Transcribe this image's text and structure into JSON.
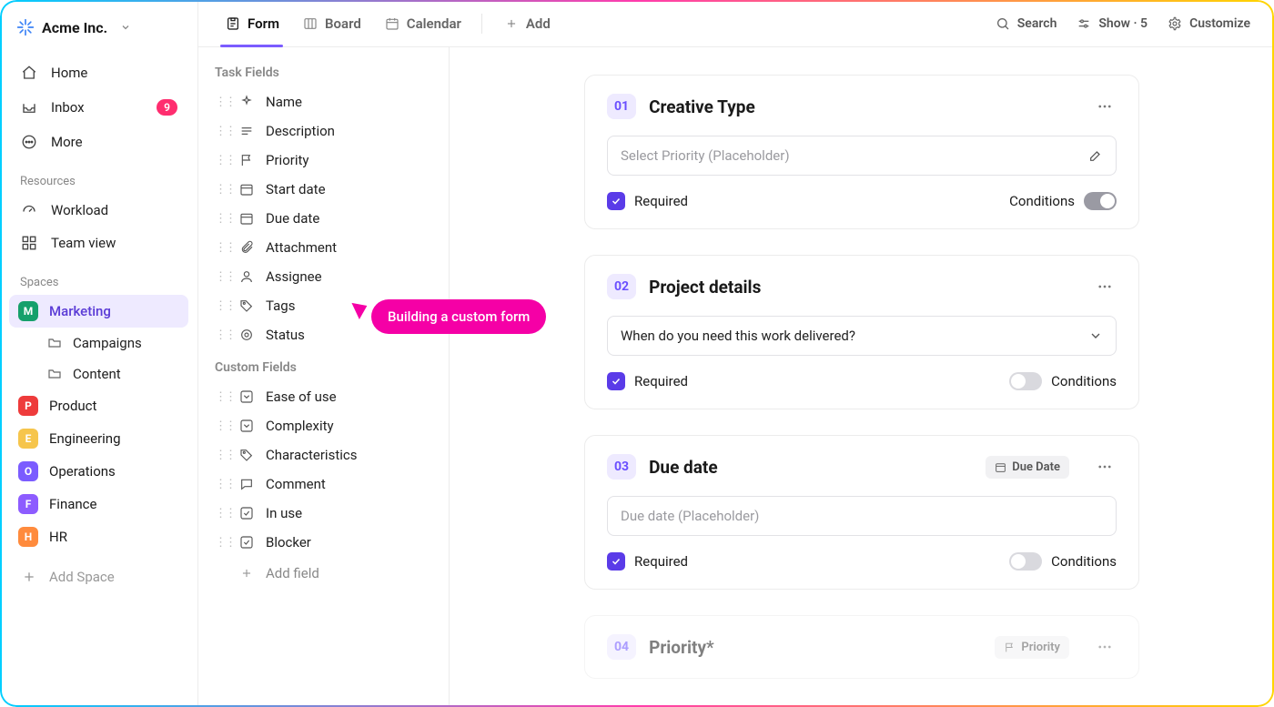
{
  "workspace": {
    "name": "Acme Inc."
  },
  "nav": {
    "home": "Home",
    "inbox": "Inbox",
    "inbox_count": "9",
    "more": "More"
  },
  "sections": {
    "resources": "Resources",
    "workload": "Workload",
    "teamview": "Team view",
    "spaces": "Spaces",
    "add_space": "Add Space"
  },
  "spaces": [
    {
      "label": "Marketing",
      "letter": "M",
      "color": "#16a06b",
      "active": true,
      "children": [
        {
          "label": "Campaigns"
        },
        {
          "label": "Content"
        }
      ]
    },
    {
      "label": "Product",
      "letter": "P",
      "color": "#ee3b3b"
    },
    {
      "label": "Engineering",
      "letter": "E",
      "color": "#f6c54c"
    },
    {
      "label": "Operations",
      "letter": "O",
      "color": "#7b5cff"
    },
    {
      "label": "Finance",
      "letter": "F",
      "color": "#8d5cff"
    },
    {
      "label": "HR",
      "letter": "H",
      "color": "#ff8b3d"
    }
  ],
  "tabs": {
    "form": "Form",
    "board": "Board",
    "calendar": "Calendar",
    "add": "Add"
  },
  "topbar": {
    "search": "Search",
    "show": "Show · 5",
    "customize": "Customize"
  },
  "fields": {
    "group_task": "Task Fields",
    "group_custom": "Custom Fields",
    "task": [
      "Name",
      "Description",
      "Priority",
      "Start date",
      "Due date",
      "Attachment",
      "Assignee",
      "Tags",
      "Status"
    ],
    "custom": [
      "Ease of use",
      "Complexity",
      "Characteristics",
      "Comment",
      "In use",
      "Blocker"
    ],
    "add_field": "Add field"
  },
  "cards": {
    "c1": {
      "num": "01",
      "title": "Creative Type",
      "placeholder": "Select Priority (Placeholder)",
      "required": "Required",
      "cond": "Conditions"
    },
    "c2": {
      "num": "02",
      "title": "Project details",
      "value": "When do you need this work delivered?",
      "required": "Required",
      "cond": "Conditions"
    },
    "c3": {
      "num": "03",
      "title": "Due date",
      "chip": "Due Date",
      "placeholder": "Due date (Placeholder)",
      "required": "Required",
      "cond": "Conditions"
    },
    "c4": {
      "num": "04",
      "title": "Priority*",
      "chip": "Priority"
    }
  },
  "tooltip": {
    "text": "Building a custom form"
  }
}
